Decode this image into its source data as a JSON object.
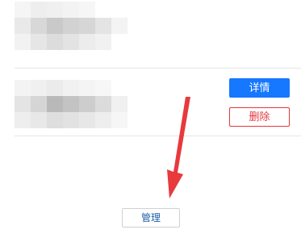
{
  "list": {
    "items": [
      {
        "buttons": []
      },
      {
        "buttons": [
          {
            "label": "详情",
            "color": "#1677ff"
          },
          {
            "label": "删除",
            "color": "#e0383e"
          }
        ]
      }
    ]
  },
  "footer": {
    "manage_label": "管理"
  },
  "annotation": {
    "arrow_color": "#e8393d"
  }
}
